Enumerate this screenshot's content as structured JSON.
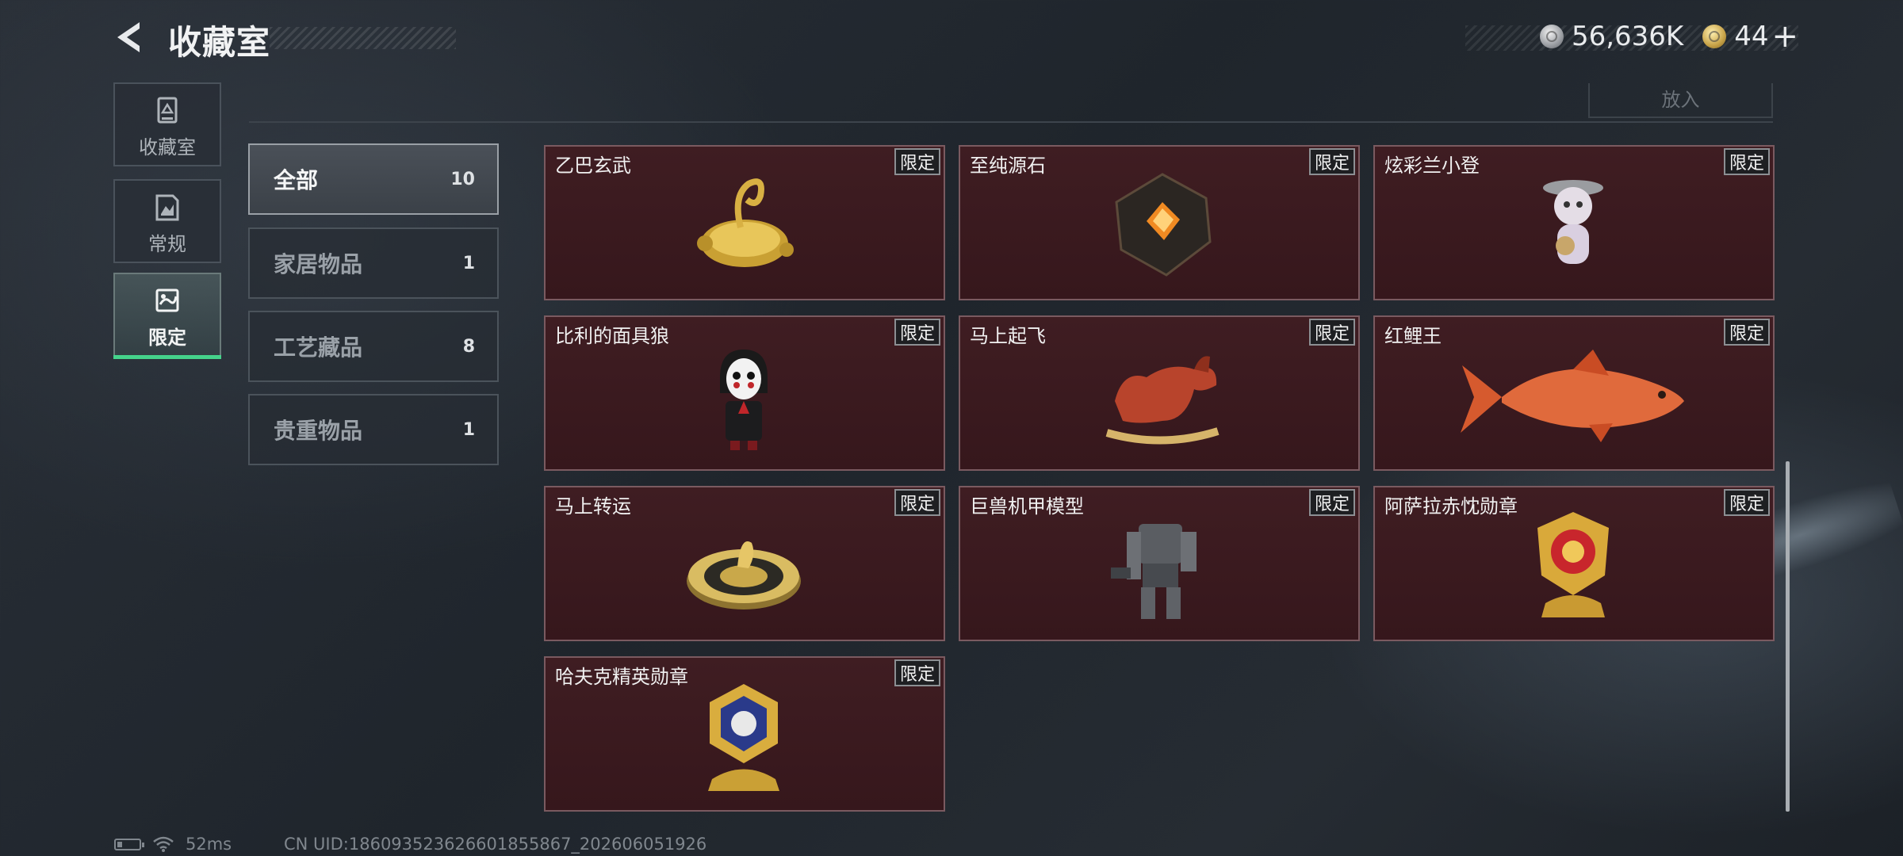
{
  "header": {
    "title": "收藏室",
    "currency_silver": "56,636K",
    "currency_gold": "44",
    "gold_plus": "+"
  },
  "sidenav": {
    "items": [
      {
        "label": "收藏室",
        "icon": "trophy-icon"
      },
      {
        "label": "常规",
        "icon": "document-icon"
      },
      {
        "label": "限定",
        "icon": "limited-icon",
        "active": true
      }
    ]
  },
  "toolbar": {
    "put_in_label": "放入"
  },
  "categories": [
    {
      "label": "全部",
      "count": "10",
      "active": true
    },
    {
      "label": "家居物品",
      "count": "1"
    },
    {
      "label": "工艺藏品",
      "count": "8"
    },
    {
      "label": "贵重物品",
      "count": "1"
    }
  ],
  "items": [
    {
      "name": "乙巴玄武",
      "badge": "限定",
      "icon": "gold-tortoise-icon"
    },
    {
      "name": "至纯源石",
      "badge": "限定",
      "icon": "crystal-stone-icon"
    },
    {
      "name": "炫彩兰小登",
      "badge": "限定",
      "icon": "figurine-icon"
    },
    {
      "name": "比利的面具狼",
      "badge": "限定",
      "icon": "puppet-doll-icon"
    },
    {
      "name": "马上起飞",
      "badge": "限定",
      "icon": "red-horse-icon"
    },
    {
      "name": "红鲤王",
      "badge": "限定",
      "icon": "red-carp-icon"
    },
    {
      "name": "马上转运",
      "badge": "限定",
      "icon": "golden-disc-icon"
    },
    {
      "name": "巨兽机甲模型",
      "badge": "限定",
      "icon": "mech-model-icon"
    },
    {
      "name": "阿萨拉赤忱勋章",
      "badge": "限定",
      "icon": "gold-medal-icon"
    },
    {
      "name": "哈夫克精英勋章",
      "badge": "限定",
      "icon": "blue-medal-icon"
    }
  ],
  "footer": {
    "ping": "52ms",
    "uid": "CN UID:186093523626601855867_202606051926"
  },
  "colors": {
    "accent_green": "#45d38b",
    "card_bg": "#3f1d22",
    "card_border": "#7a5a60"
  }
}
